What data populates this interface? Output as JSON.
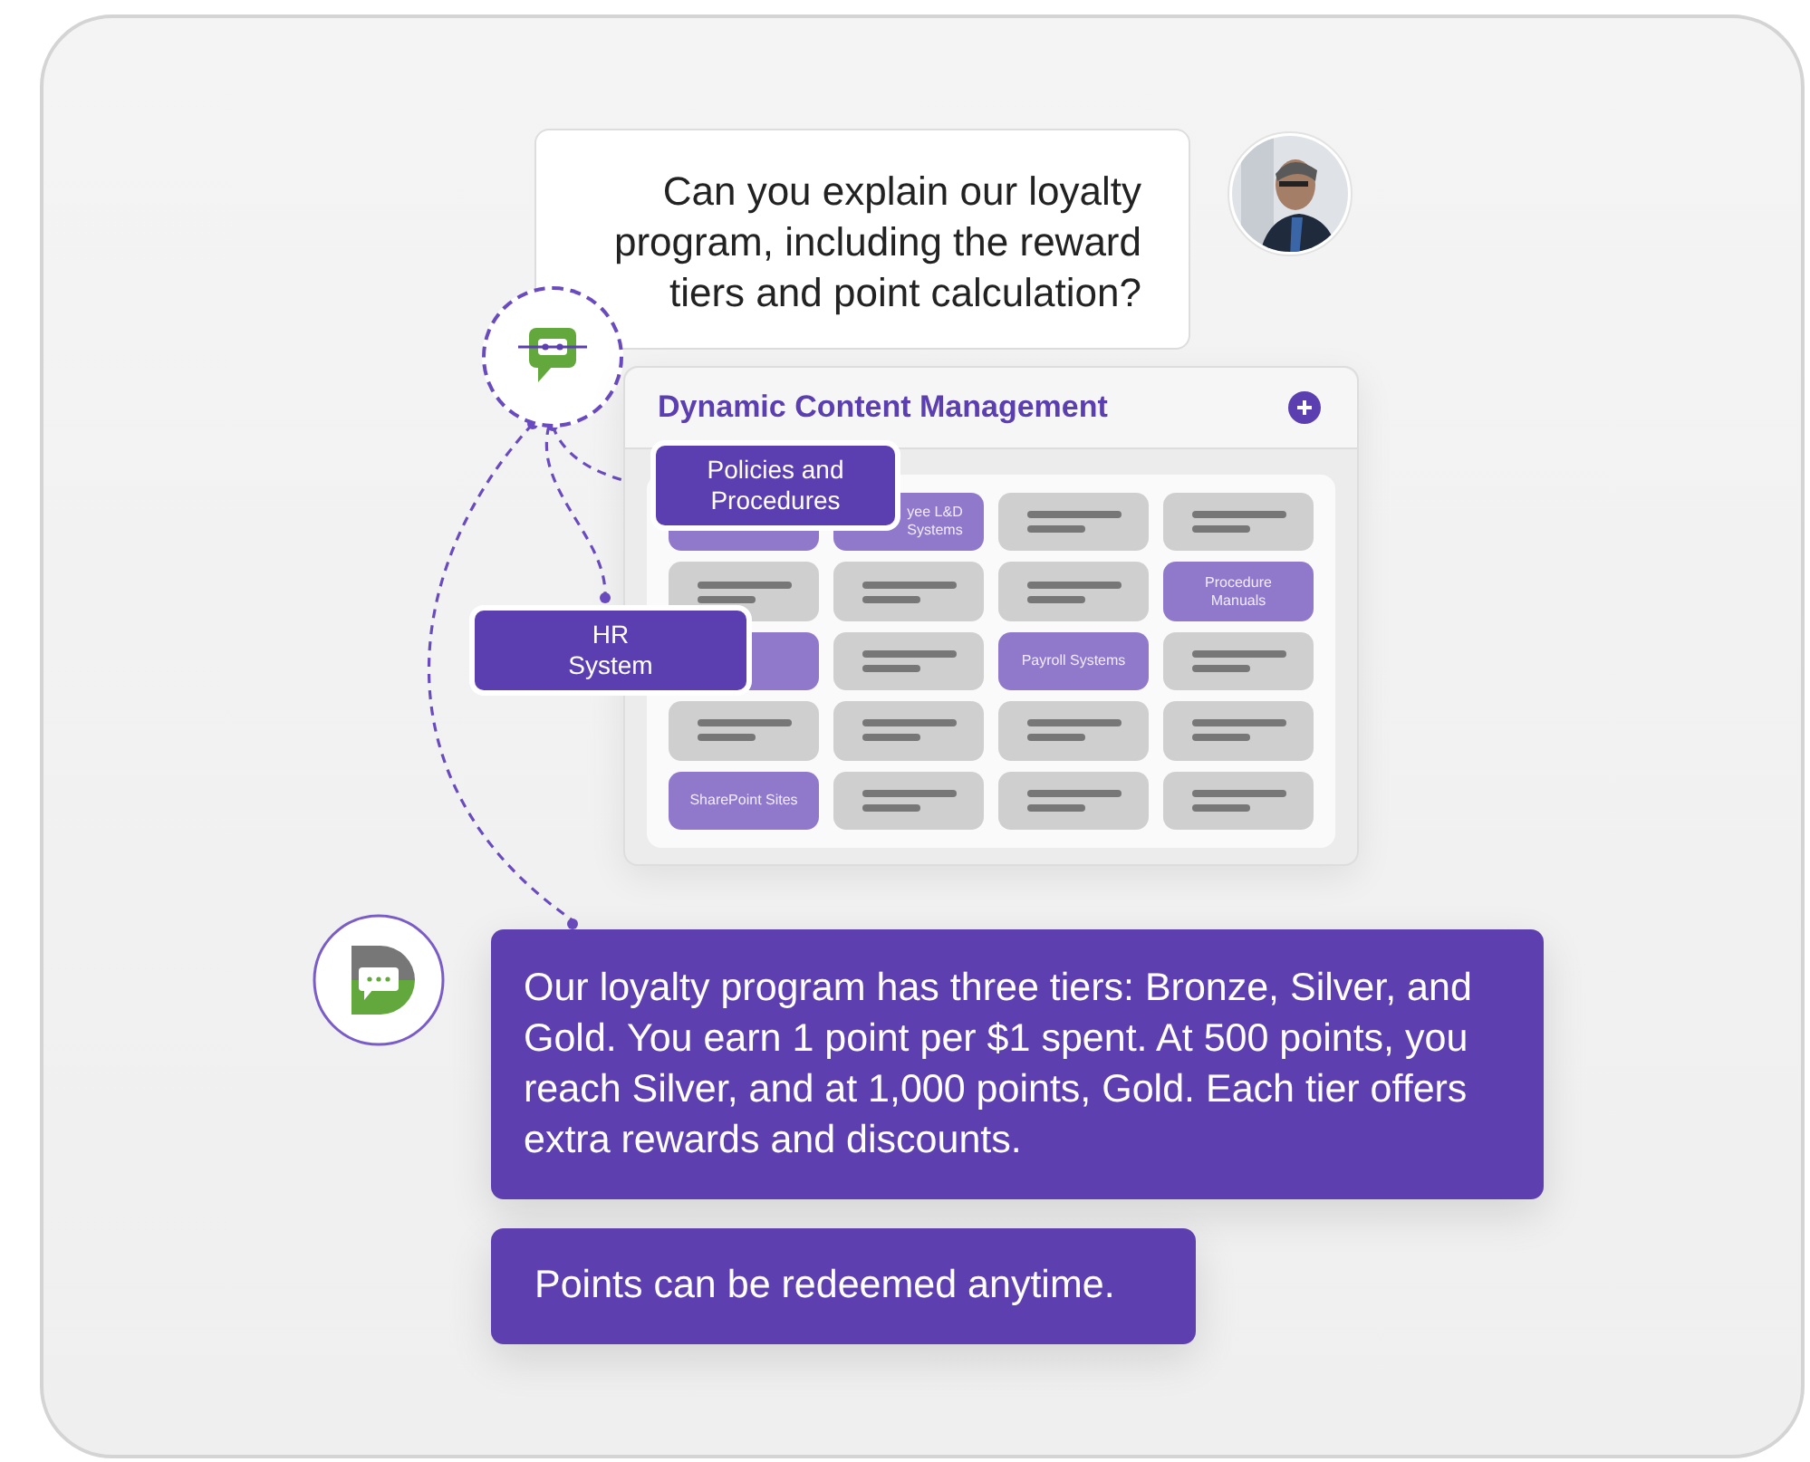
{
  "question": {
    "text": "Can you explain our loyalty program, including the reward tiers and point calculation?"
  },
  "panel": {
    "title": "Dynamic Content Management",
    "rows": [
      [
        {
          "kind": "label",
          "text": ""
        },
        {
          "kind": "covered-label",
          "text": "yee L&D Systems"
        },
        {
          "kind": "placeholder"
        },
        {
          "kind": "placeholder"
        }
      ],
      [
        {
          "kind": "placeholder"
        },
        {
          "kind": "placeholder"
        },
        {
          "kind": "placeholder"
        },
        {
          "kind": "label",
          "text": "Procedure Manuals"
        }
      ],
      [
        {
          "kind": "label",
          "text": ""
        },
        {
          "kind": "placeholder"
        },
        {
          "kind": "label",
          "text": "Payroll Systems"
        },
        {
          "kind": "placeholder"
        }
      ],
      [
        {
          "kind": "placeholder"
        },
        {
          "kind": "placeholder"
        },
        {
          "kind": "placeholder"
        },
        {
          "kind": "placeholder"
        }
      ],
      [
        {
          "kind": "label",
          "text": "SharePoint Sites"
        },
        {
          "kind": "placeholder"
        },
        {
          "kind": "placeholder"
        },
        {
          "kind": "placeholder"
        }
      ]
    ]
  },
  "sources": [
    {
      "text": "Policies and Procedures"
    },
    {
      "text": "HR System"
    }
  ],
  "answers": [
    {
      "text": "Our loyalty program has three tiers: Bronze, Silver, and Gold. You earn 1 point per $1 spent. At 500 points, you reach Silver, and at 1,000 points, Gold. Each tier offers extra rewards and discounts."
    },
    {
      "text": "Points can be redeemed anytime."
    }
  ]
}
